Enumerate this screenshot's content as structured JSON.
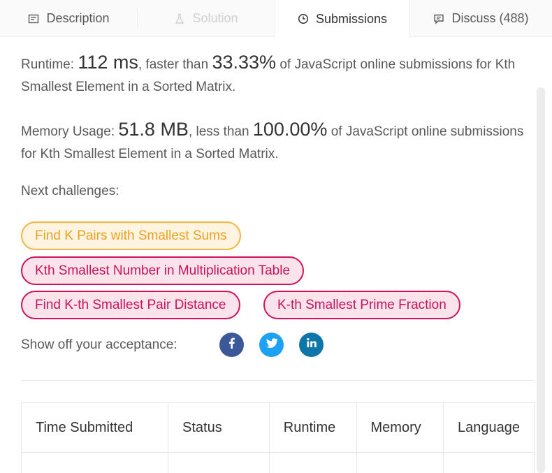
{
  "tabs": [
    {
      "label": "Description",
      "icon": "description-icon",
      "state": "normal"
    },
    {
      "label": "Solution",
      "icon": "flask-icon",
      "state": "disabled"
    },
    {
      "label": "Submissions",
      "icon": "clock-icon",
      "state": "active"
    },
    {
      "label": "Discuss (488)",
      "icon": "comment-icon",
      "state": "normal"
    }
  ],
  "result": {
    "runtime_label": "Runtime:",
    "runtime_value": "112 ms",
    "runtime_mid": ", faster than",
    "runtime_pct": "33.33%",
    "runtime_tail": "of JavaScript online submissions for Kth Smallest Element in a Sorted Matrix.",
    "memory_label": "Memory Usage:",
    "memory_value": "51.8 MB",
    "memory_mid": ", less than",
    "memory_pct": "100.00%",
    "memory_tail": "of JavaScript online submissions for Kth Smallest Element in a Sorted Matrix."
  },
  "next": {
    "label": "Next challenges:",
    "challenges": [
      {
        "title": "Find K Pairs with Smallest Sums",
        "difficulty": "medium"
      },
      {
        "title": "Kth Smallest Number in Multiplication Table",
        "difficulty": "hard"
      },
      {
        "title": "Find K-th Smallest Pair Distance",
        "difficulty": "hard"
      },
      {
        "title": "K-th Smallest Prime Fraction",
        "difficulty": "hard"
      }
    ]
  },
  "share": {
    "label": "Show off your acceptance:",
    "networks": [
      {
        "name": "facebook",
        "color": "#3b5998"
      },
      {
        "name": "twitter",
        "color": "#1da1f2"
      },
      {
        "name": "linkedin",
        "color": "#0e76a8"
      }
    ]
  },
  "table": {
    "headers": [
      "Time Submitted",
      "Status",
      "Runtime",
      "Memory",
      "Language"
    ]
  },
  "colors": {
    "medium_border": "#f5b342",
    "hard_border": "#d0135d"
  }
}
